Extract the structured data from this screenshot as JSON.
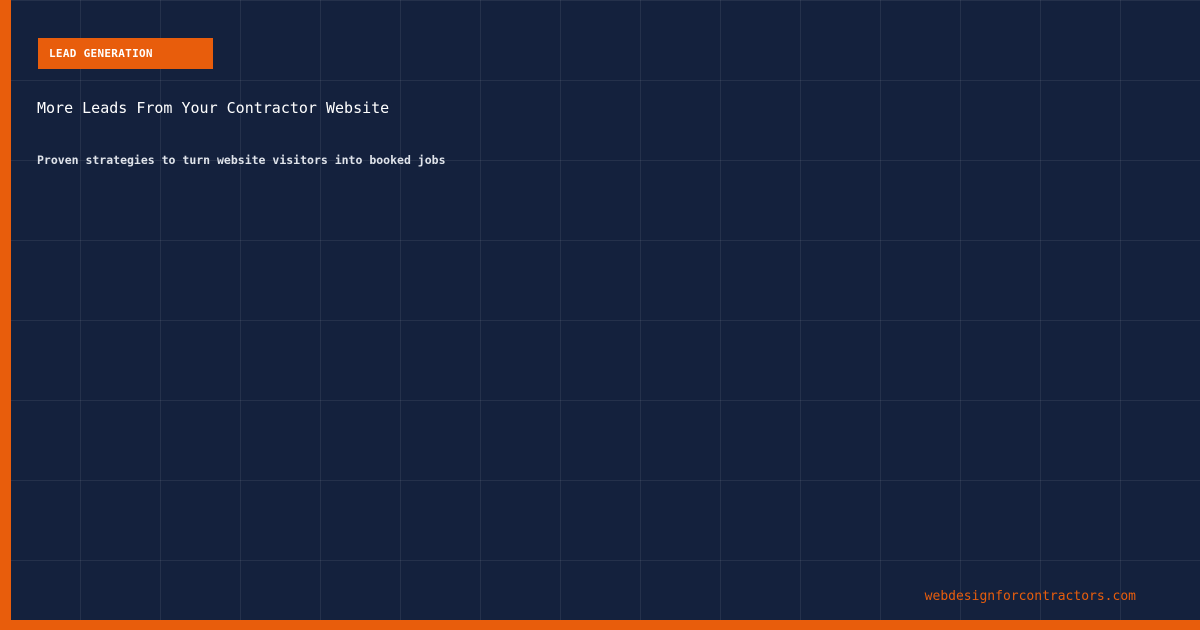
{
  "card": {
    "tag": "LEAD GENERATION",
    "title": "More Leads From Your Contractor Website",
    "subtitle": "Proven strategies to turn website visitors into booked jobs",
    "site_url": "webdesignforcontractors.com"
  },
  "colors": {
    "background": "#14213d",
    "accent": "#e85d0c",
    "text": "#ffffff"
  }
}
